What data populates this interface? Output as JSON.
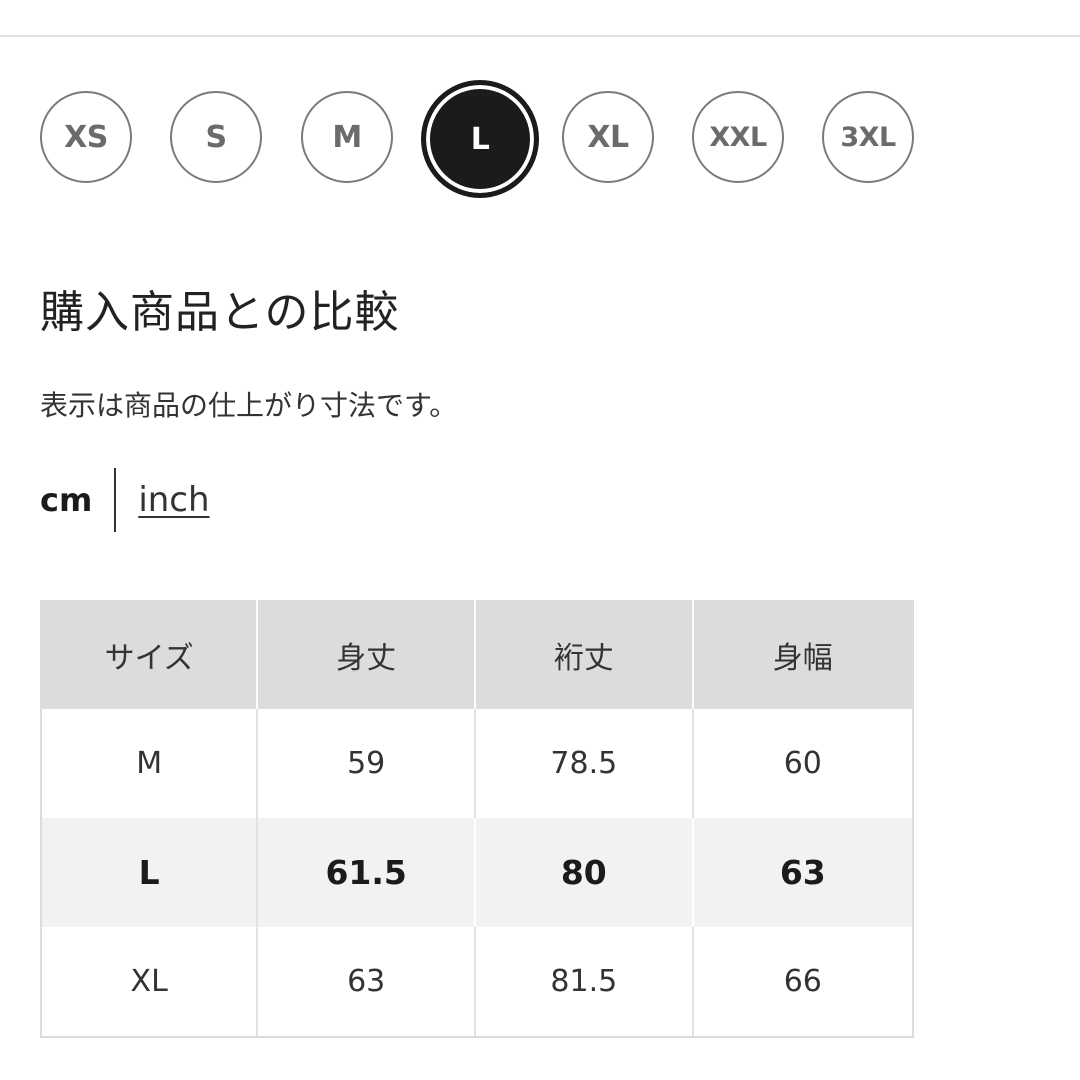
{
  "size_selector": {
    "options": [
      {
        "label": "XS",
        "selected": false
      },
      {
        "label": "S",
        "selected": false
      },
      {
        "label": "M",
        "selected": false
      },
      {
        "label": "L",
        "selected": true
      },
      {
        "label": "XL",
        "selected": false
      },
      {
        "label": "XXL",
        "selected": false
      },
      {
        "label": "3XL",
        "selected": false
      }
    ],
    "selected_value": "L"
  },
  "comparison": {
    "title": "購入商品との比較",
    "note": "表示は商品の仕上がり寸法です。"
  },
  "units": {
    "cm_label": "cm",
    "inch_label": "inch",
    "active": "cm"
  },
  "colors": {
    "selected_chip": "#1b1b1b",
    "chip_border": "#7a7a7a",
    "header_bg": "#dcdcdc",
    "highlight_row_bg": "#f2f2f2"
  },
  "table": {
    "headers": [
      "サイズ",
      "身丈",
      "裄丈",
      "身幅"
    ],
    "rows": [
      {
        "size": "M",
        "values": [
          "59",
          "78.5",
          "60"
        ],
        "highlight": false
      },
      {
        "size": "L",
        "values": [
          "61.5",
          "80",
          "63"
        ],
        "highlight": true
      },
      {
        "size": "XL",
        "values": [
          "63",
          "81.5",
          "66"
        ],
        "highlight": false
      }
    ]
  }
}
